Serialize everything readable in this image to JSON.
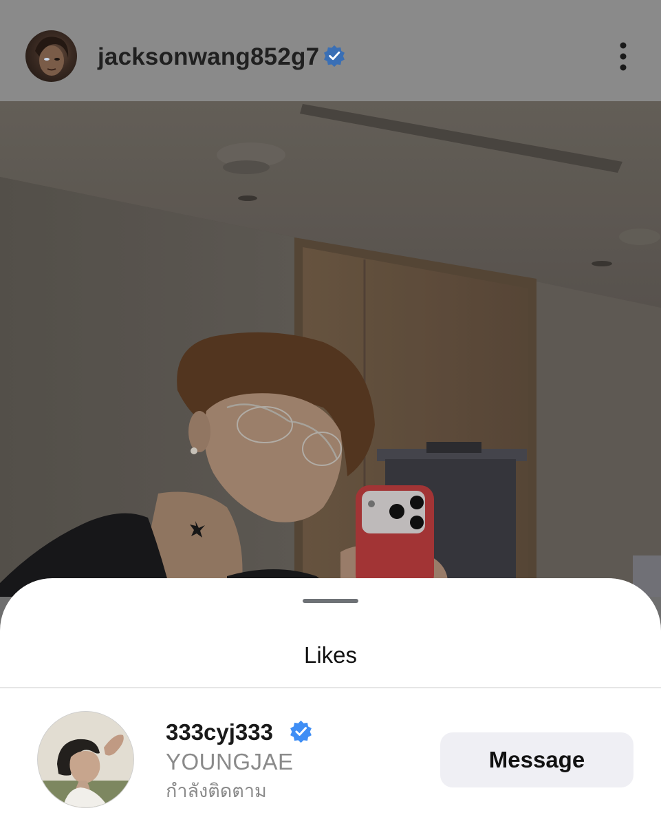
{
  "post": {
    "username": "jacksonwang852g7",
    "verified": true
  },
  "likes_sheet": {
    "title": "Likes",
    "likers": [
      {
        "username": "333cyj333",
        "full_name": "YOUNGJAE",
        "status": "กำลังติดตาม",
        "verified": true,
        "button_label": "Message"
      }
    ]
  },
  "icons": {
    "more": "more-vertical-icon",
    "verified": "verified-badge-icon"
  },
  "colors": {
    "verified_blue": "#3f8ef5",
    "header_overlay": "#8a8a8a",
    "button_bg": "#efeff4",
    "secondary_text": "#8a8a8a"
  }
}
